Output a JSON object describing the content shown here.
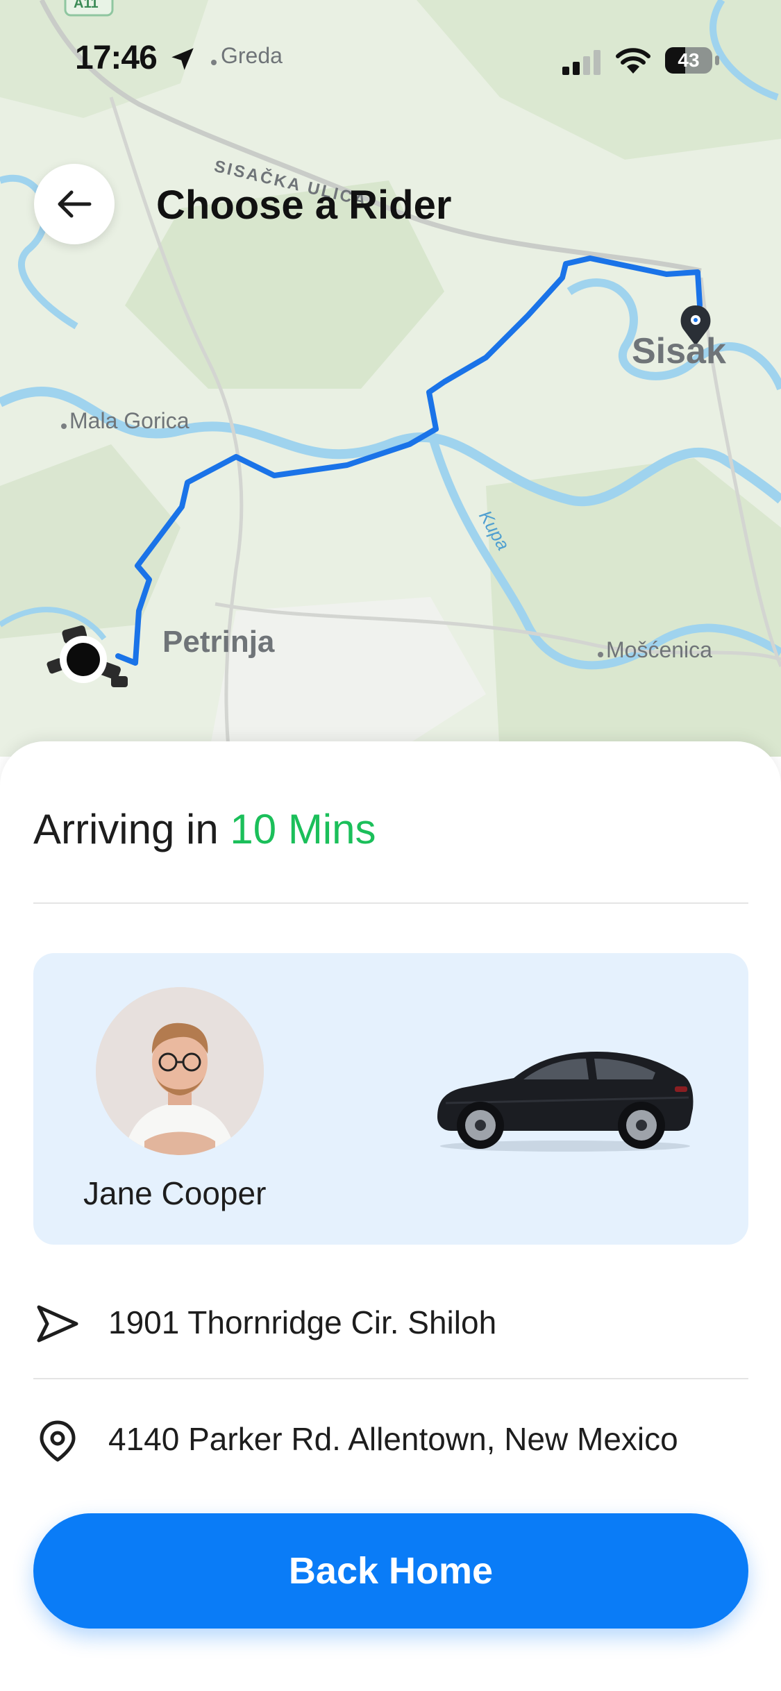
{
  "status_bar": {
    "time": "17:46",
    "battery": "43",
    "icons": [
      "location-arrow-icon",
      "signal-icon",
      "wifi-icon",
      "battery-icon"
    ]
  },
  "header": {
    "title": "Choose a Rider",
    "back_icon": "arrow-left-icon"
  },
  "map": {
    "labels": {
      "greda": "Greda",
      "sisacka": "SISAČKA ULICA",
      "mala_gorica": "Mala Gorica",
      "sisak": "Sisak",
      "kupa": "Kupa",
      "petrinja": "Petrinja",
      "moscenica": "Mošćenica",
      "road_badge": "A11"
    },
    "colors": {
      "route": "#1a73e8",
      "water": "#9fd3ee",
      "land": "#e9f0e3"
    }
  },
  "trip": {
    "arriving_prefix": "Arriving in",
    "arriving_time": "10 Mins",
    "arriving_color": "#1bbf5a"
  },
  "driver": {
    "name": "Jane Cooper"
  },
  "addresses": [
    {
      "icon": "navigation-arrow-icon",
      "text": "1901 Thornridge Cir. Shiloh"
    },
    {
      "icon": "map-pin-icon",
      "text": "4140 Parker Rd. Allentown, New Mexico"
    }
  ],
  "actions": {
    "back_home": "Back Home",
    "accent": "#0a7cf7"
  }
}
